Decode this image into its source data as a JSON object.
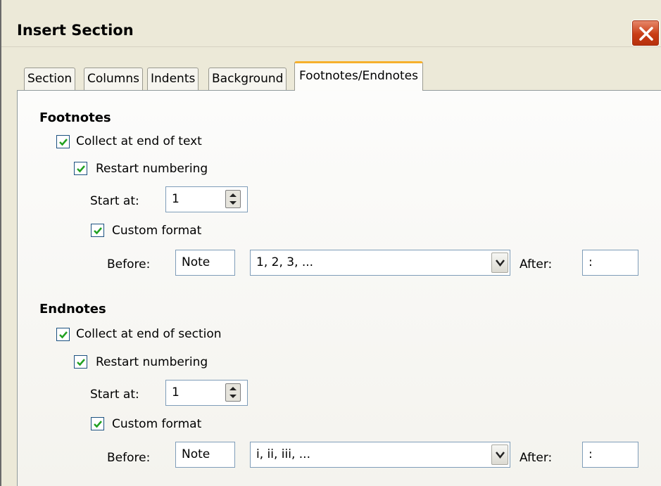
{
  "window": {
    "title": "Insert Section"
  },
  "tabs": [
    {
      "label": "Section"
    },
    {
      "label": "Columns"
    },
    {
      "label": "Indents"
    },
    {
      "label": "Background"
    },
    {
      "label": "Footnotes/Endnotes",
      "active": true
    }
  ],
  "footnotes": {
    "heading": "Footnotes",
    "collect": {
      "label": "Collect at end of text",
      "checked": true
    },
    "restart": {
      "label": "Restart numbering",
      "checked": true
    },
    "start_at": {
      "label": "Start at:",
      "value": "1"
    },
    "custom_format": {
      "label": "Custom format",
      "checked": true
    },
    "before": {
      "label": "Before:",
      "value": "Note"
    },
    "format": {
      "value": "1, 2, 3, ..."
    },
    "after": {
      "label": "After:",
      "value": ":"
    }
  },
  "endnotes": {
    "heading": "Endnotes",
    "collect": {
      "label": "Collect at end of section",
      "checked": true
    },
    "restart": {
      "label": "Restart numbering",
      "checked": true
    },
    "start_at": {
      "label": "Start at:",
      "value": "1"
    },
    "custom_format": {
      "label": "Custom format",
      "checked": true
    },
    "before": {
      "label": "Before:",
      "value": "Note"
    },
    "format": {
      "value": "i, ii, iii, ..."
    },
    "after": {
      "label": "After:",
      "value": ":"
    }
  },
  "colors": {
    "dialog_bg": "#ece9d8",
    "active_tab_accent": "#f6b02c",
    "close_button": "#c93d16",
    "checkmark": "#21a121"
  },
  "icons": [
    "close-icon",
    "checkmark-icon",
    "spin-up-icon",
    "spin-down-icon",
    "chevron-down-icon"
  ]
}
